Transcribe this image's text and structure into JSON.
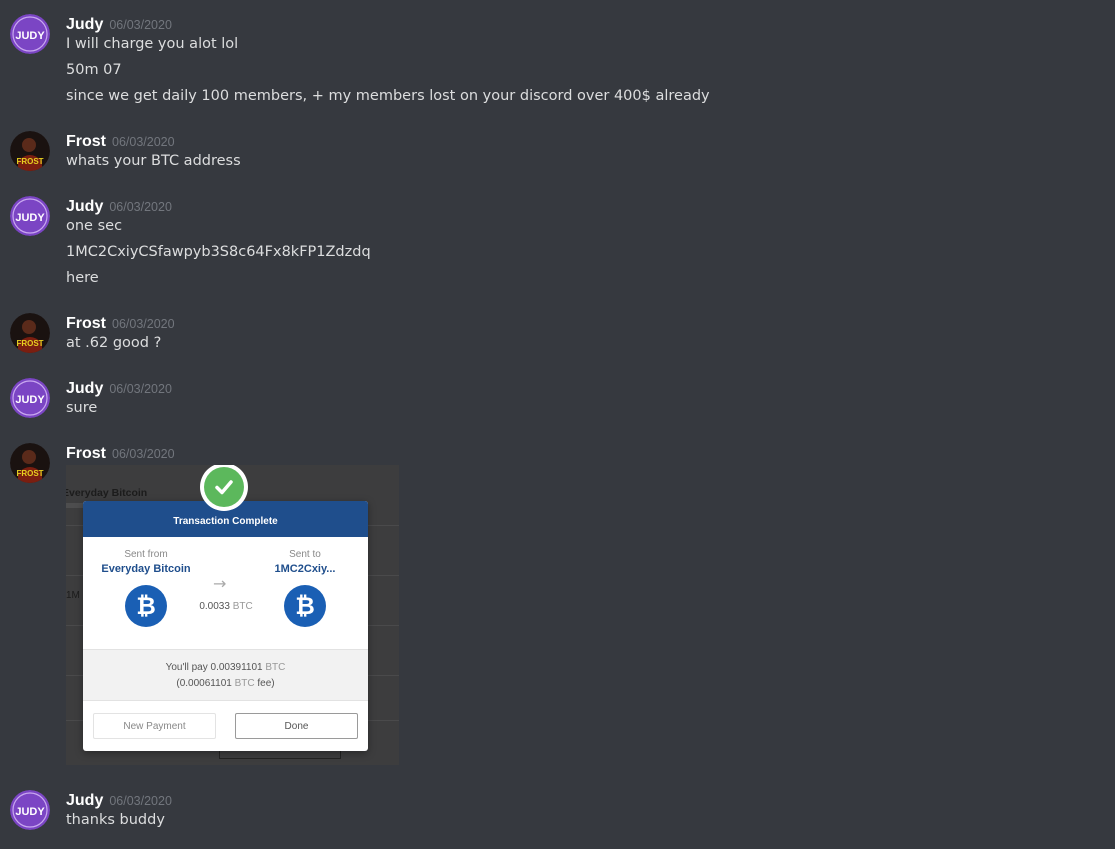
{
  "messages": [
    {
      "user": "Judy",
      "avatar": "judy-avatar",
      "timestamp": "06/03/2020",
      "lines": [
        "I will charge you alot lol",
        "50m 07",
        "since we get daily 100 members, + my members lost on your discord over 400$ already"
      ]
    },
    {
      "user": "Frost",
      "avatar": "frost-avatar",
      "timestamp": "06/03/2020",
      "lines": [
        "whats your BTC address"
      ]
    },
    {
      "user": "Judy",
      "avatar": "judy-avatar",
      "timestamp": "06/03/2020",
      "lines": [
        "one sec",
        "1MC2CxiyCSfawpyb3S8c64Fx8kFP1Zdzdq",
        "here"
      ]
    },
    {
      "user": "Frost",
      "avatar": "frost-avatar",
      "timestamp": "06/03/2020",
      "lines": [
        "at .62 good ?"
      ]
    },
    {
      "user": "Judy",
      "avatar": "judy-avatar",
      "timestamp": "06/03/2020",
      "lines": [
        "sure"
      ]
    },
    {
      "user": "Frost",
      "avatar": "frost-avatar",
      "timestamp": "06/03/2020",
      "lines": []
    },
    {
      "user": "Judy",
      "avatar": "judy-avatar",
      "timestamp": "06/03/2020",
      "lines": [
        "thanks buddy"
      ]
    }
  ],
  "attachment": {
    "bg_title": "Everyday Bitcoin",
    "bg_partial": "1M",
    "modal": {
      "title": "Transaction Complete",
      "from_label": "Sent from",
      "from_value": "Everyday Bitcoin",
      "to_label": "Sent to",
      "to_value": "1MC2Cxiy...",
      "amount": "0.0033",
      "unit": "BTC",
      "pay_prefix": "You'll pay 0.00391101",
      "fee_prefix": "(0.00061101",
      "fee_suffix": "fee)",
      "btc_symbol": "₿",
      "new_payment_label": "New Payment",
      "done_label": "Done"
    }
  },
  "colors": {
    "background": "#36393f",
    "username": "#ffffff",
    "timestamp": "#72767d",
    "text": "#dcddde",
    "modal_header": "#1f4e8c",
    "check": "#5cb85c",
    "btc_icon": "#1a5fb4"
  }
}
